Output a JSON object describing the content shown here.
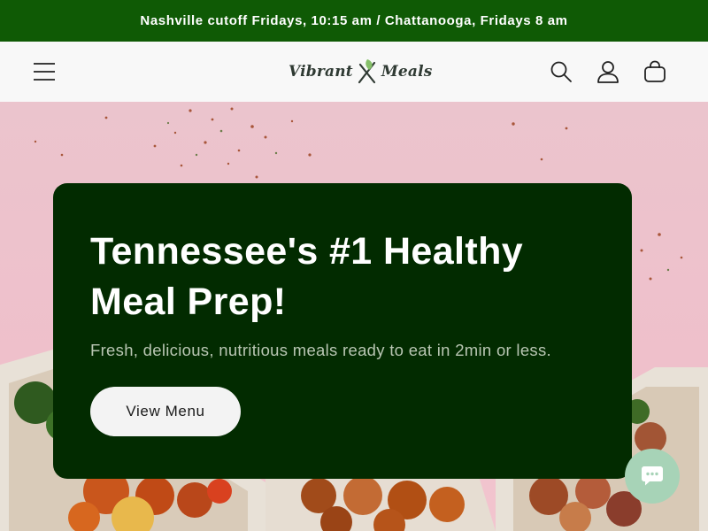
{
  "announcement": {
    "text": "Nashville cutoff Fridays, 10:15 am / Chattanooga, Fridays 8 am"
  },
  "header": {
    "logo_left": "Vibrant",
    "logo_right": "Meals",
    "icons": {
      "menu": "hamburger-menu-icon",
      "search": "search-icon",
      "account": "user-icon",
      "cart": "cart-icon",
      "logo": "fork-knife-leaf-icon"
    }
  },
  "hero": {
    "title": "Tennessee's #1 Healthy Meal Prep!",
    "subtitle": "Fresh, delicious, nutritious meals ready to eat in 2min or less.",
    "cta_label": "View Menu"
  },
  "chat": {
    "icon": "chat-bubble-icon"
  },
  "colors": {
    "announcement_bg": "#0f5a05",
    "card_bg": "#022b00",
    "hero_bg": "#efc0cb",
    "chat_bg": "#a7d3b7",
    "subtitle_text": "#b9c6b3"
  }
}
